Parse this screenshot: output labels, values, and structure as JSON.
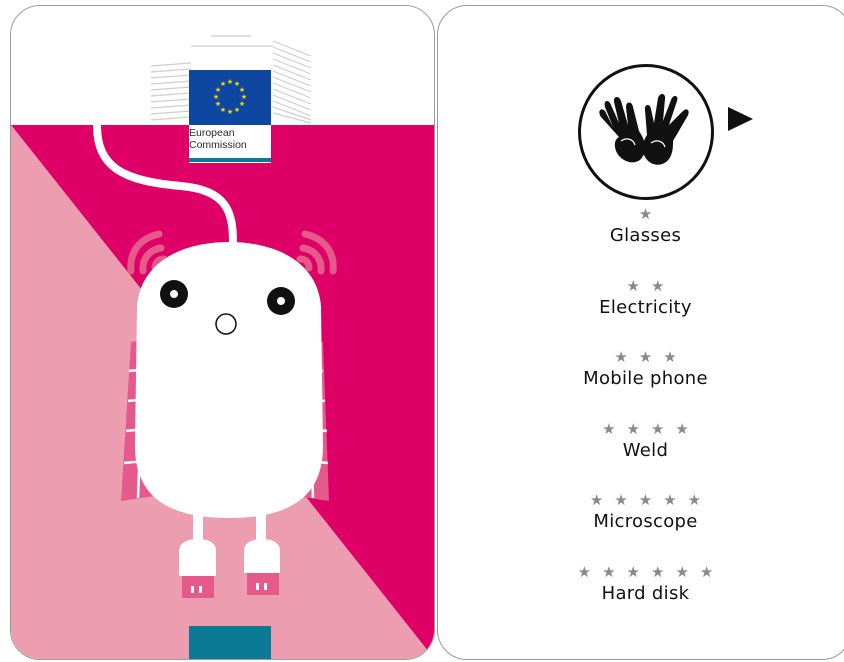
{
  "logo": {
    "line1": "European",
    "line2": "Commission",
    "emblem": "eu-flag-icon",
    "colors": {
      "flag_blue": "#0e47a1",
      "stars": "#ffd500",
      "accent_teal": "#0b7a95"
    }
  },
  "illustration": {
    "subject": "usb-robot",
    "colors": {
      "magenta": "#de0067",
      "pink": "#ed9db0",
      "robot_white": "#ffffff",
      "muscle_pink": "#e55a8b"
    }
  },
  "sign_icon": {
    "name": "sign-language-hands-icon",
    "play": "play-arrow-icon"
  },
  "levels": [
    {
      "stars": "★",
      "label": "Glasses"
    },
    {
      "stars": "★★",
      "label": "Electricity"
    },
    {
      "stars": "★★★",
      "label": "Mobile phone"
    },
    {
      "stars": "★★★★",
      "label": "Weld"
    },
    {
      "stars": "★★★★★",
      "label": "Microscope"
    },
    {
      "stars": "★★★★★★",
      "label": "Hard disk"
    }
  ]
}
